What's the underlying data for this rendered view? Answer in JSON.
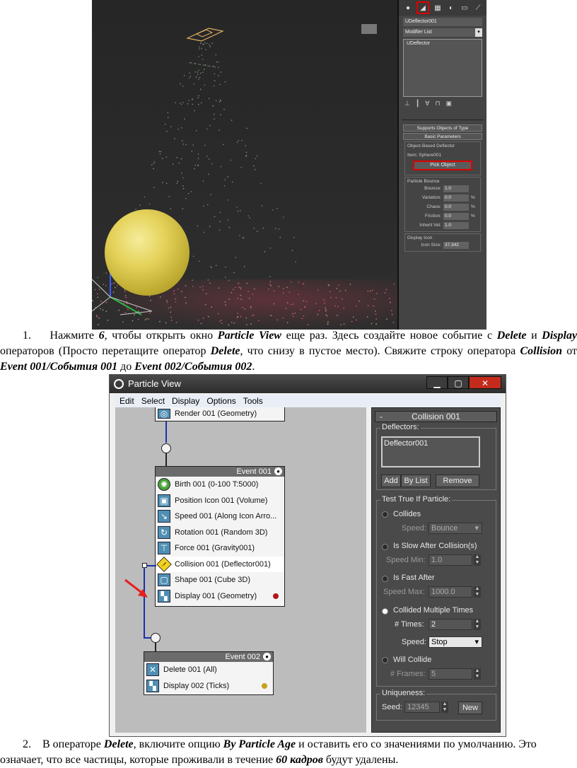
{
  "screenshot1": {
    "panel": {
      "object_name": "UDeflector001",
      "modifier_list": "Modifier List",
      "stack_item": "UDeflector",
      "rollout_supports": "Supports Objects of Type",
      "rollout_basic": "Basic Parameters",
      "group_object_based": "Object-Based Deflector",
      "item_label": "Item: Sphere001",
      "pick_object": "Pick Object",
      "group_particle_bounce": "Particle Bounce",
      "bounce": {
        "label": "Bounce:",
        "value": "1.0"
      },
      "variation": {
        "label": "Variation:",
        "value": "0.0",
        "unit": "%"
      },
      "chaos": {
        "label": "Chaos:",
        "value": "0.0",
        "unit": "%"
      },
      "friction": {
        "label": "Friction:",
        "value": "0.0",
        "unit": "%"
      },
      "inherit_vel": {
        "label": "Inherit Vel:",
        "value": "1.0"
      },
      "group_display_icon": "Display Icon",
      "icon_size": {
        "label": "Icon Size:",
        "value": "37.342"
      }
    }
  },
  "paragraph1": {
    "number": "1.",
    "t1": "Нажмите ",
    "b1": "6",
    "t2": ", чтобы открыть окно ",
    "b2": "Particle View",
    "t3": " еще раз. Здесь создайте новое событие с ",
    "b3": "Delete",
    "t4": " и ",
    "b4": "Display",
    "t5": " операторов (Просто перетащите оператор ",
    "b5": "Delete",
    "t6": ", что снизу в пустое место). Свяжите строку оператора ",
    "b6": "Collision",
    "t7": " от ",
    "b7": "Event 001/События 001",
    "t8": " до ",
    "b8": "Event 002/События 002",
    "t9": "."
  },
  "particle_view": {
    "title": "Particle View",
    "menu": [
      "Edit",
      "Select",
      "Display",
      "Options",
      "Tools"
    ],
    "render_op": "Render 001 (Geometry)",
    "event1": {
      "title": "Event 001",
      "ops": [
        "Birth 001 (0-100 T:5000)",
        "Position Icon 001 (Volume)",
        "Speed 001 (Along Icon Arro...",
        "Rotation 001 (Random 3D)",
        "Force 001 (Gravity001)",
        "Collision 001 (Deflector001)",
        "Shape 001 (Cube 3D)",
        "Display 001 (Geometry)"
      ]
    },
    "event2": {
      "title": "Event 002",
      "ops": [
        "Delete 001 (All)",
        "Display 002 (Ticks)"
      ]
    },
    "panel": {
      "minus": "-",
      "title": "Collision 001",
      "deflectors_label": "Deflectors:",
      "deflector_item": "Deflector001",
      "add": "Add",
      "by_list": "By List",
      "remove": "Remove",
      "test_label": "Test True If Particle:",
      "collides": "Collides",
      "speed_label": "Speed:",
      "speed_value": "Bounce",
      "slow": "Is Slow After Collision(s)",
      "speed_min_label": "Speed Min:",
      "speed_min_value": "1.0",
      "fast": "Is Fast After",
      "speed_max_label": "Speed Max:",
      "speed_max_value": "1000.0",
      "multiple": "Collided Multiple Times",
      "times_label": "# Times:",
      "times_value": "2",
      "speed2_label": "Speed:",
      "speed2_value": "Stop",
      "will_collide": "Will Collide",
      "frames_label": "# Frames:",
      "frames_value": "5",
      "uniqueness_label": "Uniqueness:",
      "seed_label": "Seed:",
      "seed_value": "12345",
      "new": "New"
    }
  },
  "paragraph2": {
    "number": "2.",
    "t1": "В операторе ",
    "b1": "Delete",
    "t2": ", включите опцию ",
    "b2": "By Particle Age",
    "t3": " и оставить его со значениями по умолчанию. Это означает, что все частицы, которые проживали в течение ",
    "b3": "60 кадров",
    "t4": " будут удалены."
  },
  "colors": {
    "red_highlight": "#d00000",
    "wire_blue": "#1a2fb0",
    "event_dot_red": "#b01818",
    "event_dot_gold": "#c8a020"
  }
}
